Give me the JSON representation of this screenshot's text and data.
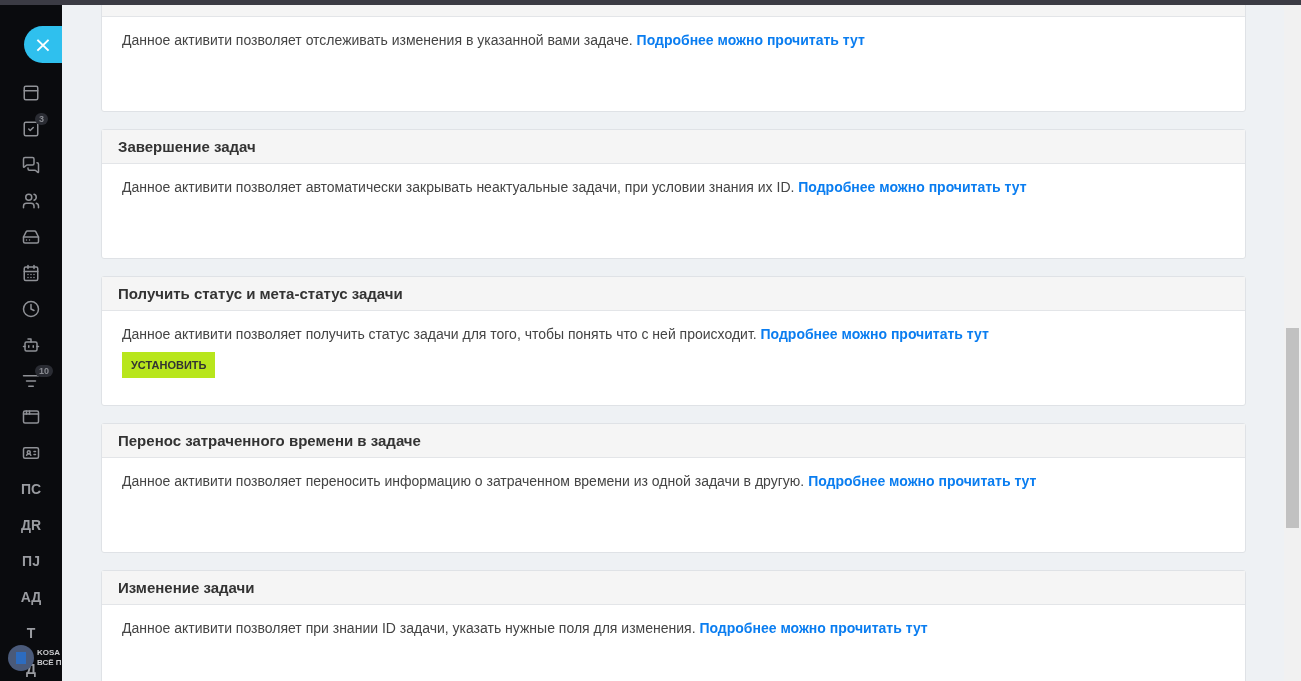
{
  "sidebar": {
    "close_button": "×",
    "items": [
      {
        "kind": "icon"
      },
      {
        "kind": "icon",
        "badge": "3"
      },
      {
        "kind": "icon"
      },
      {
        "kind": "icon"
      },
      {
        "kind": "icon"
      },
      {
        "kind": "icon"
      },
      {
        "kind": "icon"
      },
      {
        "kind": "icon"
      },
      {
        "kind": "icon",
        "badge": "10"
      },
      {
        "kind": "icon"
      },
      {
        "kind": "icon"
      },
      {
        "kind": "text",
        "label": "ПС"
      },
      {
        "kind": "text",
        "label": "ДR"
      },
      {
        "kind": "text",
        "label": "ПЈ"
      },
      {
        "kind": "text",
        "label": "АД"
      },
      {
        "kind": "text",
        "label": "Т"
      },
      {
        "kind": "text",
        "label": "Д"
      }
    ],
    "logo": {
      "line_1": "KOSA",
      "line_2": "ВСЁ П"
    }
  },
  "cards": [
    {
      "description": "Данное активити позволяет отслеживать изменения в указанной вами задаче.",
      "link": "Подробнее можно прочитать тут"
    },
    {
      "title": "Завершение задач",
      "description": "Данное активити позволяет автоматически закрывать неактуальные задачи, при условии знания их ID.",
      "link": "Подробнее можно прочитать тут"
    },
    {
      "title": "Получить статус и мета-статус задачи",
      "description": "Данное активити позволяет получить статус задачи для того, чтобы понять что с ней происходит.",
      "link": "Подробнее можно прочитать тут",
      "button": "УСТАНОВИТЬ"
    },
    {
      "title": "Перенос затраченного времени в задаче",
      "description": "Данное активити позволяет переносить информацию о затраченном времени из одной задачи в другую.",
      "link": "Подробнее можно прочитать тут"
    },
    {
      "title": "Изменение задачи",
      "description": "Данное активити позволяет при знании ID задачи, указать нужные поля для изменения.",
      "link": "Подробнее можно прочитать тут"
    }
  ]
}
